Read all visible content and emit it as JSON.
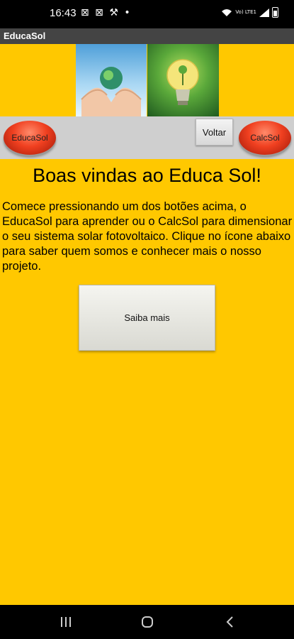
{
  "status_bar": {
    "time": "16:43",
    "notification_icons": "⊠ ⊠ ⚒ •",
    "network_label": "Vo) LTE1"
  },
  "app_bar": {
    "title": "EducaSol"
  },
  "toolbar": {
    "educasol_label": "EducaSol",
    "voltar_label": "Voltar",
    "calcsol_label": "CalcSol"
  },
  "main": {
    "welcome": "Boas vindas ao Educa Sol!",
    "intro": "Comece pressionando um dos botões acima, o EducaSol para aprender ou o CalcSol para dimensionar o seu sistema solar fotovoltaico. Clique no ícone abaixo para saber quem somos e conhecer mais o nosso projeto.",
    "saiba_label": "Saiba mais"
  },
  "colors": {
    "background": "#ffc800",
    "app_bar": "#444444",
    "toolbar": "#cfcfcf",
    "red_button": "#f04020"
  },
  "icons": [
    "wifi-icon",
    "signal-icon",
    "battery-icon",
    "recents-icon",
    "home-icon",
    "back-icon"
  ]
}
